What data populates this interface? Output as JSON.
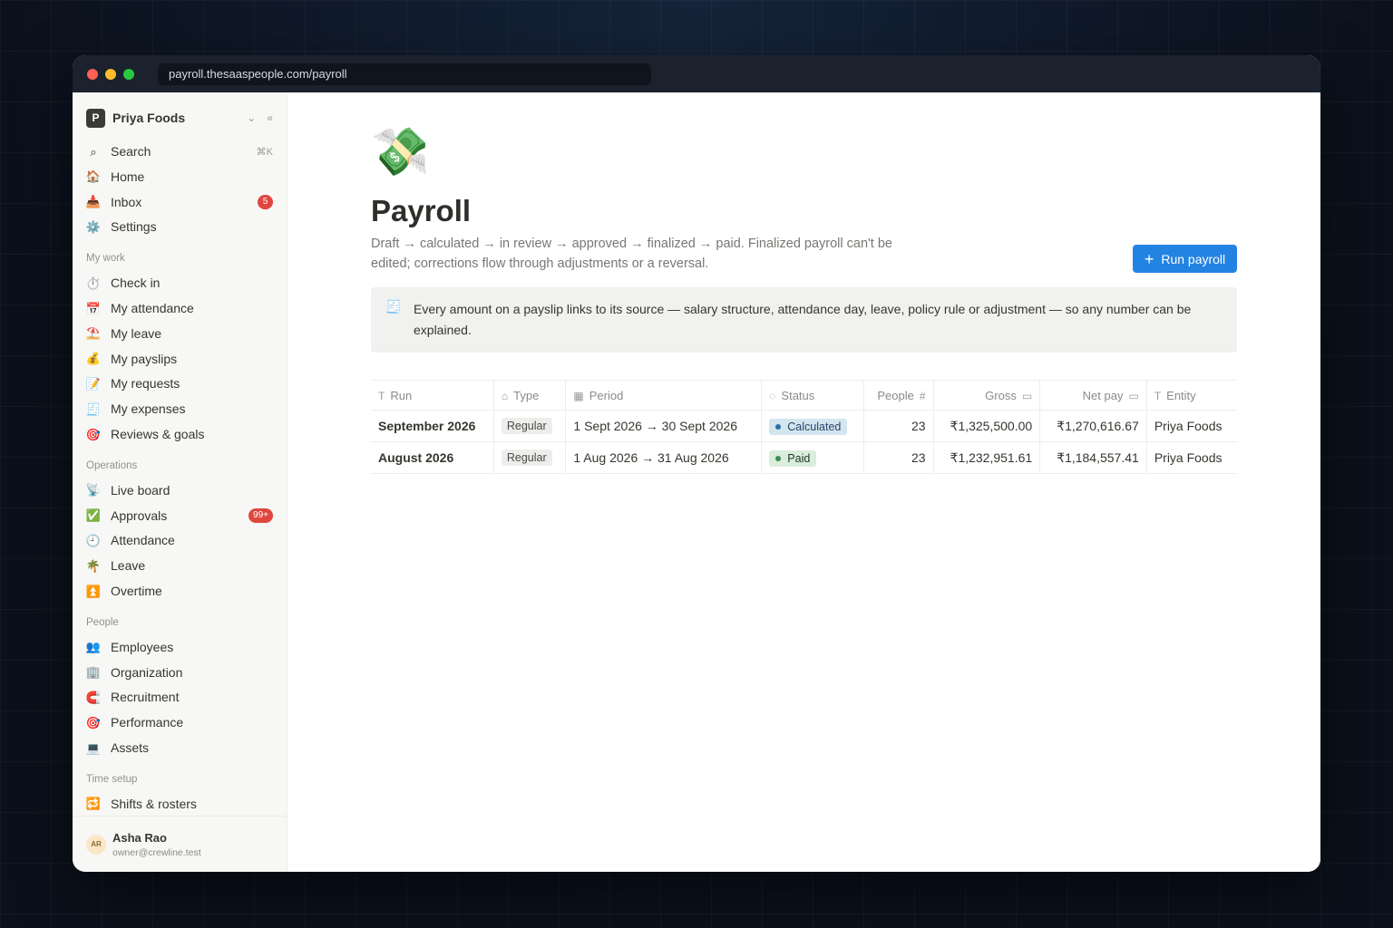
{
  "browser": {
    "url": "payroll.thesaaspeople.com/payroll"
  },
  "workspace": {
    "logo_letter": "P",
    "name": "Priya Foods"
  },
  "sidebar": {
    "top": [
      {
        "icon": "search-icon",
        "glyph": "⌕",
        "label": "Search",
        "shortcut": "⌘K"
      },
      {
        "icon": "home-icon",
        "glyph": "🏠",
        "label": "Home"
      },
      {
        "icon": "inbox-icon",
        "glyph": "📥",
        "label": "Inbox",
        "badge": "5"
      },
      {
        "icon": "settings-icon",
        "glyph": "⚙️",
        "label": "Settings"
      }
    ],
    "sections": [
      {
        "title": "My work",
        "items": [
          {
            "icon": "stopwatch-icon",
            "glyph": "⏱️",
            "label": "Check in"
          },
          {
            "icon": "calendar-icon",
            "glyph": "📅",
            "label": "My attendance"
          },
          {
            "icon": "beach-icon",
            "glyph": "⛱️",
            "label": "My leave"
          },
          {
            "icon": "money-bag-icon",
            "glyph": "💰",
            "label": "My payslips"
          },
          {
            "icon": "memo-icon",
            "glyph": "📝",
            "label": "My requests"
          },
          {
            "icon": "receipt-icon",
            "glyph": "🧾",
            "label": "My expenses"
          },
          {
            "icon": "target-icon",
            "glyph": "🎯",
            "label": "Reviews & goals"
          }
        ]
      },
      {
        "title": "Operations",
        "items": [
          {
            "icon": "satellite-icon",
            "glyph": "📡",
            "label": "Live board"
          },
          {
            "icon": "check-box-icon",
            "glyph": "✅",
            "label": "Approvals",
            "badge": "99+"
          },
          {
            "icon": "clock-icon",
            "glyph": "🕘",
            "label": "Attendance"
          },
          {
            "icon": "palm-tree-icon",
            "glyph": "🌴",
            "label": "Leave"
          },
          {
            "icon": "overtime-icon",
            "glyph": "⏫",
            "label": "Overtime"
          }
        ]
      },
      {
        "title": "People",
        "items": [
          {
            "icon": "people-icon",
            "glyph": "👥",
            "label": "Employees"
          },
          {
            "icon": "building-icon",
            "glyph": "🏢",
            "label": "Organization"
          },
          {
            "icon": "magnet-icon",
            "glyph": "🧲",
            "label": "Recruitment"
          },
          {
            "icon": "target-icon",
            "glyph": "🎯",
            "label": "Performance"
          },
          {
            "icon": "laptop-icon",
            "glyph": "💻",
            "label": "Assets"
          }
        ]
      },
      {
        "title": "Time setup",
        "items": [
          {
            "icon": "repeat-icon",
            "glyph": "🔁",
            "label": "Shifts & rosters"
          }
        ]
      }
    ]
  },
  "user": {
    "initials": "AR",
    "name": "Asha Rao",
    "email": "owner@crewline.test"
  },
  "page": {
    "emoji": "💸",
    "title": "Payroll",
    "description": "Draft → calculated → in review → approved → finalized → paid. Finalized payroll can't be edited; corrections flow through adjustments or a reversal.",
    "run_button": "Run payroll",
    "callout": {
      "icon": "receipt-icon",
      "text": "Every amount on a payslip links to its source — salary structure, attendance day, leave, policy rule or adjustment — so any number can be explained."
    }
  },
  "table": {
    "columns": [
      {
        "key": "run",
        "label": "Run",
        "icon": "text-icon",
        "glyph": "T"
      },
      {
        "key": "type",
        "label": "Type",
        "icon": "tag-icon",
        "glyph": "⌂"
      },
      {
        "key": "period",
        "label": "Period",
        "icon": "calendar-icon",
        "glyph": "▦"
      },
      {
        "key": "status",
        "label": "Status",
        "icon": "status-icon",
        "glyph": "◌"
      },
      {
        "key": "people",
        "label": "People",
        "icon": "number-icon",
        "glyph": "#",
        "num": true
      },
      {
        "key": "gross",
        "label": "Gross",
        "icon": "currency-icon",
        "glyph": "▭",
        "num": true
      },
      {
        "key": "net_pay",
        "label": "Net pay",
        "icon": "currency-icon",
        "glyph": "▭",
        "num": true
      },
      {
        "key": "entity",
        "label": "Entity",
        "icon": "text-icon",
        "glyph": "T"
      }
    ],
    "rows": [
      {
        "run": "September 2026",
        "type": "Regular",
        "period": "1 Sept 2026 → 30 Sept 2026",
        "status": "Calculated",
        "status_kind": "calculated",
        "people": "23",
        "gross": "₹1,325,500.00",
        "net_pay": "₹1,270,616.67",
        "entity": "Priya Foods"
      },
      {
        "run": "August 2026",
        "type": "Regular",
        "period": "1 Aug 2026 → 31 Aug 2026",
        "status": "Paid",
        "status_kind": "paid",
        "people": "23",
        "gross": "₹1,232,951.61",
        "net_pay": "₹1,184,557.41",
        "entity": "Priya Foods"
      }
    ]
  }
}
